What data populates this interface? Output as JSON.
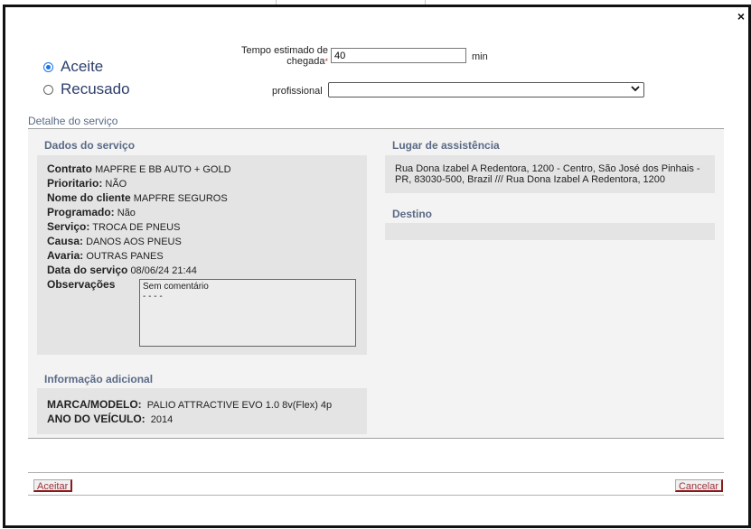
{
  "response": {
    "options": [
      {
        "label": "Aceite",
        "checked": true
      },
      {
        "label": "Recusado",
        "checked": false
      }
    ],
    "eta_label_line1": "Tempo estimado de",
    "eta_label_line2": "chegada",
    "eta_required_mark": "*",
    "eta_value": "40",
    "eta_unit": "min",
    "professional_label": "profissional",
    "professional_value": ""
  },
  "detail": {
    "title": "Detalhe do serviço",
    "service": {
      "title": "Dados do serviço",
      "fields": [
        {
          "label": "Contrato",
          "value": "MAPFRE E BB AUTO + GOLD"
        },
        {
          "label": "Prioritario:",
          "value": "NÃO"
        },
        {
          "label": "Nome do cliente",
          "value": "MAPFRE SEGUROS"
        },
        {
          "label": "Programado:",
          "value": "Não"
        },
        {
          "label": "Serviço:",
          "value": "TROCA DE PNEUS"
        },
        {
          "label": "Causa:",
          "value": "DANOS AOS PNEUS"
        },
        {
          "label": "Avaria:",
          "value": "OUTRAS PANES"
        },
        {
          "label": "Data do serviço",
          "value": "08/06/24 21:44"
        }
      ],
      "observations_label": "Observações",
      "observations_line1": "Sem comentário",
      "observations_line2": "- - - -"
    },
    "additional": {
      "title": "Informação adicional",
      "fields": [
        {
          "label": "MARCA/MODELO:",
          "value": "PALIO ATTRACTIVE EVO 1.0 8v(Flex) 4p"
        },
        {
          "label": "ANO DO VEÍCULO:",
          "value": "2014"
        }
      ]
    },
    "location": {
      "title": "Lugar de assistência",
      "address": "Rua Dona Izabel A Redentora, 1200 - Centro, São José dos Pinhais - PR, 83030-500, Brazil /// Rua Dona Izabel A Redentora, 1200"
    },
    "destination": {
      "title": "Destino",
      "value": ""
    }
  },
  "buttons": {
    "accept": "Aceitar",
    "cancel": "Cancelar"
  },
  "close_glyph": "×"
}
